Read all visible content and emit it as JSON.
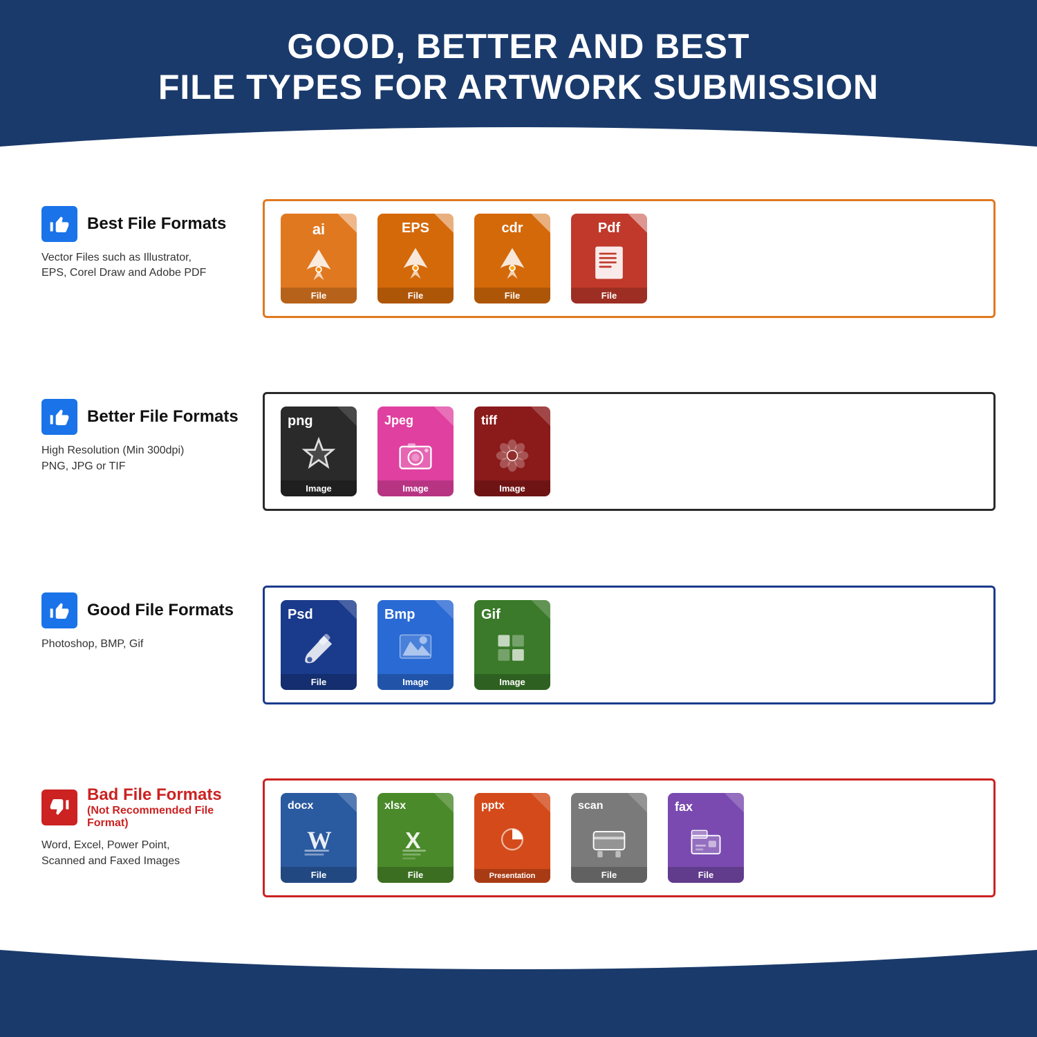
{
  "header": {
    "title_line1": "GOOD, BETTER AND BEST",
    "title_line2": "FILE TYPES FOR ARTWORK SUBMISSION"
  },
  "rows": [
    {
      "id": "best",
      "thumb": "up",
      "title": "Best File Formats",
      "subtitle": "",
      "description": "Vector Files such as Illustrator,\nEPS, Corel Draw and Adobe PDF",
      "border_color": "orange",
      "files": [
        {
          "ext": "ai",
          "label": "File",
          "color": "orange",
          "icon": "pen-nib"
        },
        {
          "ext": "EPS",
          "label": "File",
          "color": "orange2",
          "icon": "pen-nib"
        },
        {
          "ext": "cdr",
          "label": "File",
          "color": "orange2",
          "icon": "pen-nib"
        },
        {
          "ext": "Pdf",
          "label": "File",
          "color": "red-file",
          "icon": "document"
        }
      ]
    },
    {
      "id": "better",
      "thumb": "up",
      "title": "Better File Formats",
      "subtitle": "",
      "description": "High Resolution (Min 300dpi)\nPNG, JPG or TIF",
      "border_color": "dark",
      "files": [
        {
          "ext": "png",
          "label": "Image",
          "color": "dark-gray",
          "icon": "star-shape"
        },
        {
          "ext": "Jpeg",
          "label": "Image",
          "color": "pink",
          "icon": "camera"
        },
        {
          "ext": "tiff",
          "label": "Image",
          "color": "dark-red",
          "icon": "flower"
        }
      ]
    },
    {
      "id": "good",
      "thumb": "up",
      "title": "Good File Formats",
      "subtitle": "",
      "description": "Photoshop, BMP, Gif",
      "border_color": "blue",
      "files": [
        {
          "ext": "Psd",
          "label": "File",
          "color": "dark-blue",
          "icon": "brush"
        },
        {
          "ext": "Bmp",
          "label": "Image",
          "color": "blue-file",
          "icon": "mountain"
        },
        {
          "ext": "Gif",
          "label": "Image",
          "color": "green-file",
          "icon": "grid"
        }
      ]
    },
    {
      "id": "bad",
      "thumb": "down",
      "title": "Bad File Formats",
      "subtitle": "(Not Recommended File Format)",
      "description": "Word, Excel, Power Point,\nScanned and Faxed Images",
      "border_color": "red",
      "files": [
        {
          "ext": "docx",
          "label": "File",
          "color": "blue-docx",
          "icon": "word"
        },
        {
          "ext": "xlsx",
          "label": "File",
          "color": "green-xlsx",
          "icon": "excel"
        },
        {
          "ext": "pptx",
          "label": "Presentation",
          "color": "orange-pptx",
          "icon": "ppt"
        },
        {
          "ext": "scan",
          "label": "File",
          "color": "gray-scan",
          "icon": "scanner"
        },
        {
          "ext": "fax",
          "label": "File",
          "color": "purple-fax",
          "icon": "fax"
        }
      ]
    }
  ]
}
